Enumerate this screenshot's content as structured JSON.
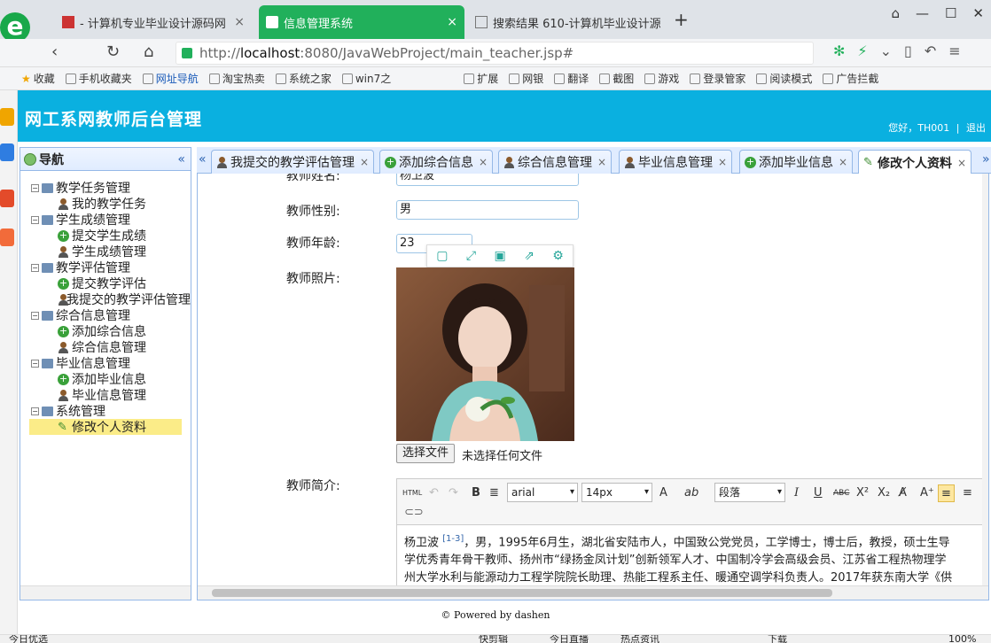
{
  "browser": {
    "logo": "e",
    "tabs": [
      {
        "title": "- 计算机专业毕业设计源码网",
        "close": "×"
      },
      {
        "title": "信息管理系统",
        "close": "×"
      },
      {
        "title": "搜索结果 610-计算机毕业设计源",
        "close": "×"
      }
    ],
    "new_tab": "+",
    "window_buttons": [
      "⌂",
      "—",
      "☐",
      "✕"
    ],
    "address_scheme": "http://",
    "address_host": "localhost",
    "address_path": ":8080/JavaWebProject/main_teacher.jsp#",
    "bookmarks": [
      "收藏",
      "手机收藏夹",
      "网址导航",
      "淘宝热卖",
      "系统之家",
      "win7之",
      "扩展",
      "网银",
      "翻译",
      "截图",
      "游戏",
      "登录管家",
      "阅读模式",
      "广告拦截"
    ]
  },
  "app": {
    "title": "网工系网教师后台管理",
    "greeting": "您好，TH001",
    "separator": "|",
    "logout": "退出"
  },
  "nav": {
    "title": "导航",
    "collapse": "«",
    "groups": [
      {
        "label": "教学任务管理",
        "items": [
          {
            "label": "我的教学任务",
            "icon": "user-icon"
          }
        ]
      },
      {
        "label": "学生成绩管理",
        "items": [
          {
            "label": "提交学生成绩",
            "icon": "add-icon"
          },
          {
            "label": "学生成绩管理",
            "icon": "user-icon"
          }
        ]
      },
      {
        "label": "教学评估管理",
        "items": [
          {
            "label": "提交教学评估",
            "icon": "add-icon"
          },
          {
            "label": "我提交的教学评估管理",
            "icon": "user-icon"
          }
        ]
      },
      {
        "label": "综合信息管理",
        "items": [
          {
            "label": "添加综合信息",
            "icon": "add-icon"
          },
          {
            "label": "综合信息管理",
            "icon": "user-icon"
          }
        ]
      },
      {
        "label": "毕业信息管理",
        "items": [
          {
            "label": "添加毕业信息",
            "icon": "add-icon"
          },
          {
            "label": "毕业信息管理",
            "icon": "user-icon"
          }
        ]
      },
      {
        "label": "系统管理",
        "items": [
          {
            "label": "修改个人资料",
            "icon": "pen-icon",
            "selected": true
          }
        ]
      }
    ]
  },
  "tabs": [
    {
      "label": "我提交的教学评估管理",
      "icon": "user-icon"
    },
    {
      "label": "添加综合信息",
      "icon": "add-icon"
    },
    {
      "label": "综合信息管理",
      "icon": "user-icon"
    },
    {
      "label": "毕业信息管理",
      "icon": "user-icon"
    },
    {
      "label": "添加毕业信息",
      "icon": "add-icon"
    },
    {
      "label": "修改个人资料",
      "icon": "pen-icon",
      "active": true
    }
  ],
  "tab_close": "×",
  "form": {
    "name_label": "教师姓名:",
    "name_value": "杨卫波",
    "gender_label": "教师性别:",
    "gender_value": "男",
    "age_label": "教师年龄:",
    "age_value": "23",
    "photo_label": "教师照片:",
    "file_button": "选择文件",
    "file_status": "未选择任何文件",
    "intro_label": "教师简介:",
    "editor": {
      "html_btn": "HTML",
      "bold": "B",
      "font_family": "arial",
      "font_size": "14px",
      "paragraph": "段落",
      "italic": "I",
      "underline": "U",
      "strike": "ABC",
      "sup": "X²",
      "sub": "X₂",
      "font_color": "A",
      "bg_color": "ab"
    },
    "intro_sup": "[1-3]",
    "intro_line1_head": "杨卫波",
    "intro_line1_rest": "，男，1995年6月生，湖北省安陆市人，中国致公党党员，工学博士，博士后，教授，硕士生导",
    "intro_line2": "学优秀青年骨干教师、扬州市“绿扬金凤计划”创新领军人才、中国制冷学会高级会员、江苏省工程热物理学",
    "intro_line3": "州大学水利与能源动力工程学院院长助理、热能工程系主任、暖通空调学科负责人。2017年获东南大学《供"
  },
  "footer": "© Powered by dashen",
  "status_bar": [
    "今日优选",
    "快剪辑",
    "今日直播",
    "热点资讯",
    "下载",
    "100%"
  ],
  "colors": {
    "header": "#0ab0e0",
    "active_browser_tab": "#21b05b",
    "tree_selected": "#fbec88",
    "panel_border": "#95b8e7"
  }
}
